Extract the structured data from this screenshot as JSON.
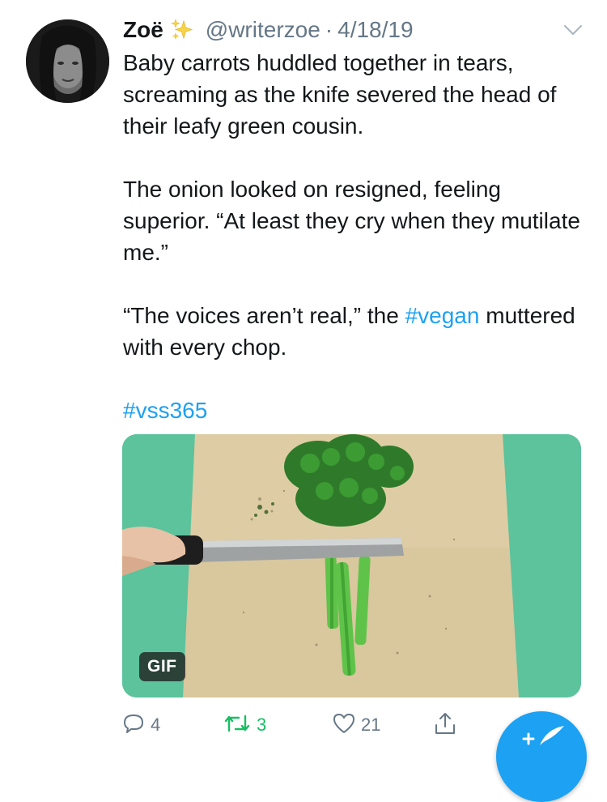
{
  "tweet": {
    "author_name": "Zoë",
    "author_handle": "@writerzoe",
    "separator": "·",
    "date": "4/18/19",
    "paragraph1": "Baby carrots huddled together in tears, screaming as the knife severed the head of their leafy green cousin.",
    "paragraph2": "The onion looked on resigned, feeling superior. “At least they cry when they mutilate me.”",
    "paragraph3_before": "“The voices aren’t real,” the ",
    "paragraph3_hashtag": "#vegan",
    "paragraph3_after": " muttered with every chop.",
    "hashtag_line": "#vss365"
  },
  "media": {
    "badge": "GIF"
  },
  "actions": {
    "reply_count": "4",
    "retweet_count": "3",
    "like_count": "21"
  },
  "colors": {
    "link": "#1da1f2",
    "muted": "#657786",
    "retweet": "#17bf63",
    "fab": "#1da1f2"
  },
  "icons": [
    "avatar",
    "sparkles-icon",
    "chevron-down-icon",
    "reply-icon",
    "retweet-icon",
    "like-icon",
    "share-icon",
    "compose-icon"
  ]
}
